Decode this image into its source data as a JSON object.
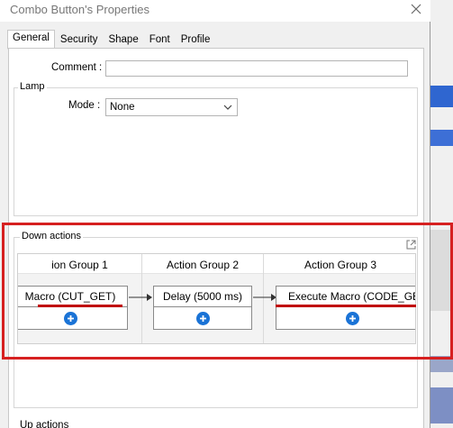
{
  "dialog": {
    "title": "Combo Button's Properties"
  },
  "tabs": [
    {
      "label": "General",
      "active": true
    },
    {
      "label": "Security",
      "active": false
    },
    {
      "label": "Shape",
      "active": false
    },
    {
      "label": "Font",
      "active": false
    },
    {
      "label": "Profile",
      "active": false
    }
  ],
  "general": {
    "comment_label": "Comment :",
    "comment_value": "",
    "lamp_group_title": "Lamp",
    "mode_label": "Mode :",
    "mode_value": "None"
  },
  "down_actions": {
    "title": "Down actions",
    "groups": [
      {
        "header": "ion Group 1",
        "action": "Macro (CUT_GET)"
      },
      {
        "header": "Action Group 2",
        "action": "Delay (5000 ms)"
      },
      {
        "header": "Action Group 3",
        "action": "Execute Macro (CODE_GET"
      }
    ]
  },
  "up_actions": {
    "title": "Up actions"
  },
  "colors": {
    "highlight_frame": "#d62020",
    "underline": "#c00000",
    "add_button": "#1a73d6"
  }
}
